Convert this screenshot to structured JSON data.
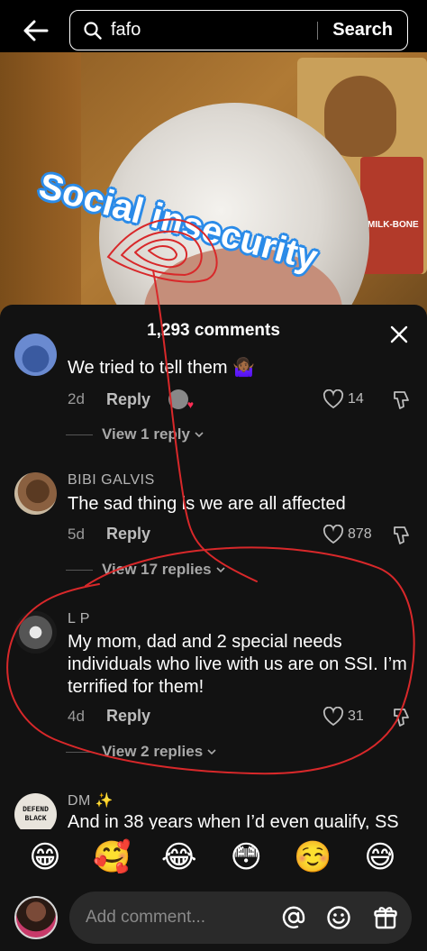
{
  "search": {
    "query": "fafo",
    "button_label": "Search"
  },
  "video": {
    "overlay_text": "Social insecurity",
    "poster_label": "MILK-BONE"
  },
  "comments_header": {
    "count_label": "1,293 comments"
  },
  "comments": [
    {
      "user": "",
      "text": "We tried to tell them 🤷🏾‍♀️",
      "time": "2d",
      "reply_label": "Reply",
      "likes": "14",
      "view_replies": "View 1 reply"
    },
    {
      "user": "BIBI GALVIS",
      "text": "The sad thing is we are all affected",
      "time": "5d",
      "reply_label": "Reply",
      "likes": "878",
      "view_replies": "View 17 replies"
    },
    {
      "user": "L P",
      "text": "My mom, dad and 2 special needs individuals who live with us are on SSI. I’m terrified for them!",
      "time": "4d",
      "reply_label": "Reply",
      "likes": "31",
      "view_replies": "View 2 replies"
    },
    {
      "user": "DM ✨",
      "text": "And in 38 years when I’d even qualify, SS",
      "avatar_text": "DEFEND BLACK"
    }
  ],
  "emoji_bar": [
    "😁",
    "🥰",
    "😂",
    "😳",
    "☺️",
    "😅"
  ],
  "comment_input": {
    "placeholder": "Add comment..."
  },
  "colors": {
    "sheet_bg": "#121212",
    "annotation_red": "#d8282a",
    "overlay_blue": "#2b8be8"
  }
}
